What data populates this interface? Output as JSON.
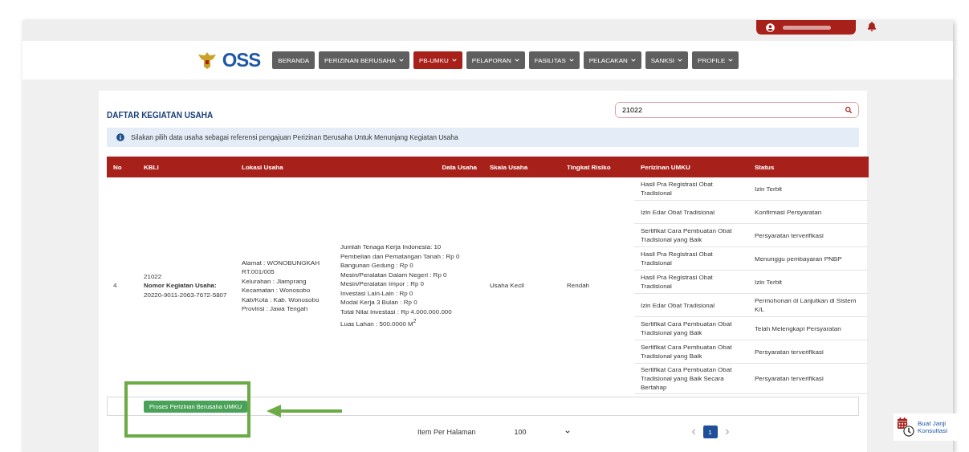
{
  "brand": {
    "name": "OSS"
  },
  "nav": [
    {
      "label": "BERANDA",
      "dropdown": false,
      "selected": false
    },
    {
      "label": "PERIZINAN BERUSAHA",
      "dropdown": true,
      "selected": false
    },
    {
      "label": "PB-UMKU",
      "dropdown": true,
      "selected": true
    },
    {
      "label": "PELAPORAN",
      "dropdown": true,
      "selected": false
    },
    {
      "label": "FASILITAS",
      "dropdown": true,
      "selected": false
    },
    {
      "label": "PELACAKAN",
      "dropdown": true,
      "selected": false
    },
    {
      "label": "SANKSI",
      "dropdown": true,
      "selected": false
    },
    {
      "label": "PROFILE",
      "dropdown": true,
      "selected": false
    }
  ],
  "card": {
    "title": "DAFTAR KEGIATAN USAHA",
    "search": {
      "value": "21022"
    },
    "info": "Silakan pilih data usaha sebagai referensi pengajuan Perizinan Berusaha Untuk Menunjang Kegiatan Usaha"
  },
  "table": {
    "columns": [
      "No",
      "KBLI",
      "Lokasi Usaha",
      "Data Usaha",
      "Skala Usaha",
      "Tingkat Risiko",
      "Perizinan UMKU",
      "Status"
    ],
    "rows": [
      {
        "no": "4",
        "kbli": {
          "code": "21022",
          "label": "Nomor Kegiatan Usaha:",
          "number": "20220-9011-2063-7672-5807"
        },
        "lokasi": [
          "Alamat : WONOBUNGKAH RT.001/005",
          "Kelurahan : Jlamprang",
          "Kecamatan : Wonosobo",
          "Kab/Kota : Kab. Wonosobo",
          "Provinsi : Jawa Tengah"
        ],
        "data_usaha": [
          "Jumlah Tenaga Kerja Indonesia: 10",
          "Pembelian dan Pematangan Tanah : Rp 0",
          "Bangunan Gedung : Rp 0",
          "Mesin/Peralatan Dalam Negeri : Rp 0",
          "Mesin/Peralatan Impor : Rp 0",
          "Investasi Lain-Lain : Rp 0",
          "Modal Kerja 3 Bulan : Rp 0",
          "Total Nilai Investasi : Rp 4.000.000.000",
          "Luas Lahan : 500.0000 M$^{2}$"
        ],
        "skala": "Usaha Kecil",
        "risiko": "Rendah",
        "permits": [
          {
            "name": "Hasil Pra Registrasi Obat Tradisional",
            "status": "Izin Terbit"
          },
          {
            "name": "Izin Edar Obat Tradisional",
            "status": "Konfirmasi Persyaratan"
          },
          {
            "name": "Sertifikat Cara Pembuatan Obat Tradisional yang Baik",
            "status": "Persyaratan terverifikasi"
          },
          {
            "name": "Hasil Pra Registrasi Obat Tradisional",
            "status": "Menunggu pembayaran PNBP"
          },
          {
            "name": "Hasil Pra Registrasi Obat Tradisional",
            "status": "Izin Terbit"
          },
          {
            "name": "Izin Edar Obat Tradisional",
            "status": "Permohonan di Lanjutkan di Sistem K/L"
          },
          {
            "name": "Sertifikat Cara Pembuatan Obat Tradisional yang Baik",
            "status": "Telah Melengkapi Persyaratan"
          },
          {
            "name": "Sertifikat Cara Pembuatan Obat Tradisional yang Baik",
            "status": "Persyaratan terverifikasi"
          },
          {
            "name": "Sertifikat Cara Pembuatan Obat Tradisional yang Baik Secara Bertahap",
            "status": "Persyaratan terverifikasi"
          }
        ]
      }
    ]
  },
  "action_button": "Proses Perizinan Berusaha UMKU",
  "pagination": {
    "label": "Item Per Halaman",
    "per_page": "100",
    "pages": [
      {
        "label": "1",
        "selected": true
      }
    ]
  },
  "consult_widget": {
    "label": "Buat Janji Konsultasi"
  }
}
